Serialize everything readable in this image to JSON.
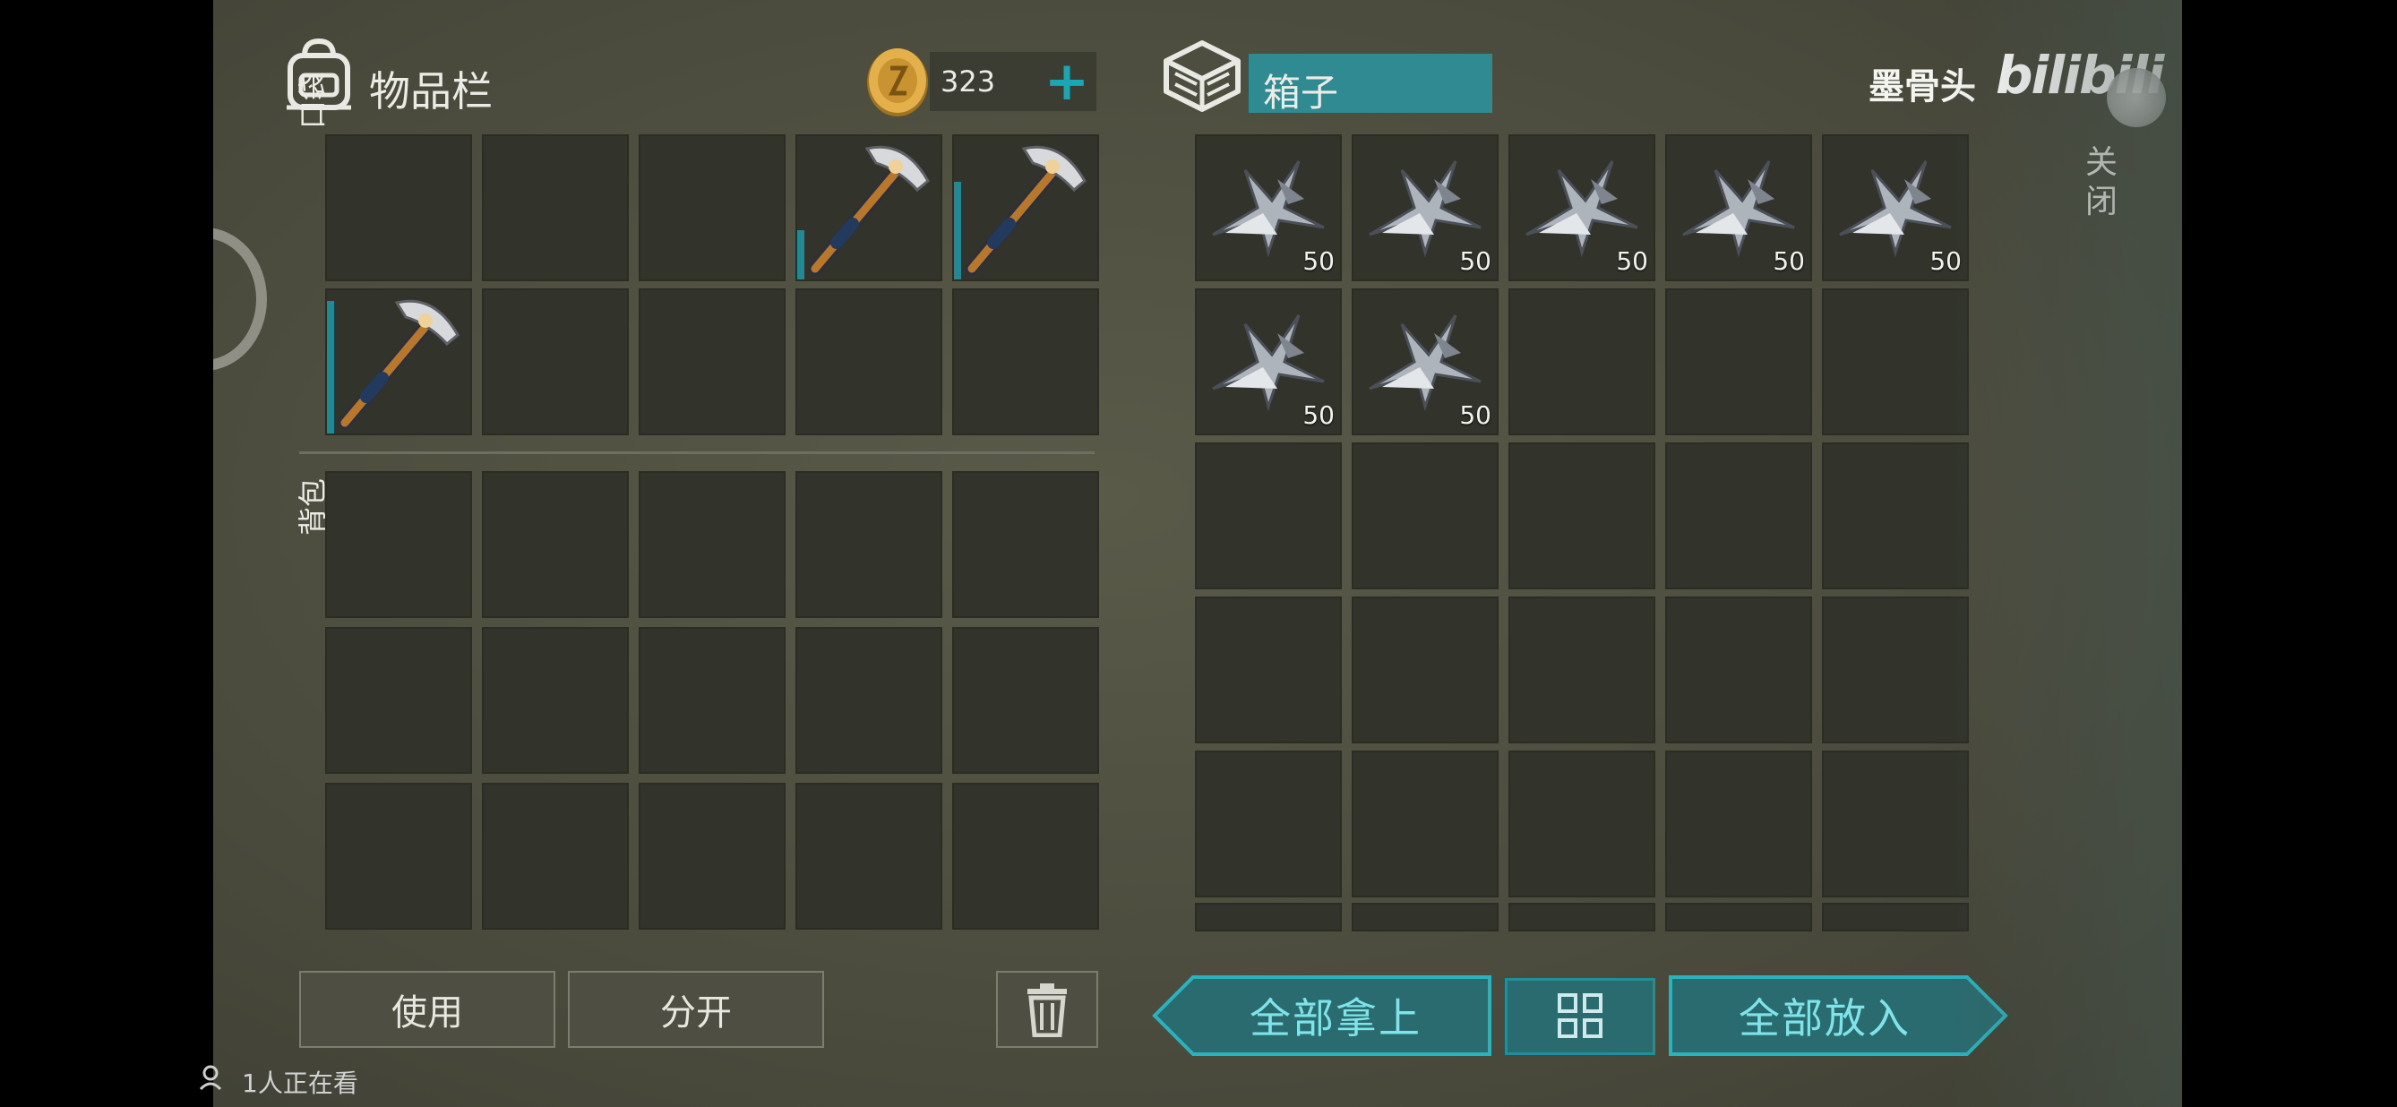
{
  "inventory": {
    "title": "物品栏",
    "coins": "323",
    "add_coins_label": "+",
    "pocket_label": "口袋",
    "backpack_label": "背包",
    "pocket_slots": [
      {
        "item": null
      },
      {
        "item": null
      },
      {
        "item": null
      },
      {
        "item": "pickaxe",
        "durability": 0.35
      },
      {
        "item": "pickaxe",
        "durability": 0.7
      },
      {
        "item": "pickaxe",
        "durability": 0.95
      },
      {
        "item": null
      },
      {
        "item": null
      },
      {
        "item": null
      },
      {
        "item": null
      }
    ],
    "use_button": "使用",
    "split_button": "分开",
    "trash_icon": "trash-icon"
  },
  "container": {
    "title": "箱子",
    "icon": "crate-icon",
    "slots": [
      {
        "item": "metal-scraps",
        "count": "50"
      },
      {
        "item": "metal-scraps",
        "count": "50"
      },
      {
        "item": "metal-scraps",
        "count": "50"
      },
      {
        "item": "metal-scraps",
        "count": "50"
      },
      {
        "item": "metal-scraps",
        "count": "50"
      },
      {
        "item": "metal-scraps",
        "count": "50"
      },
      {
        "item": "metal-scraps",
        "count": "50"
      }
    ],
    "take_all_button": "全部拿上",
    "sort_icon": "grid-icon",
    "put_all_button": "全部放入"
  },
  "close_label": "关闭",
  "watermark": {
    "author": "墨骨头",
    "logo": "bilibili"
  },
  "viewers": "1人正在看",
  "colors": {
    "accent": "#1aa7b4",
    "teal_text": "#7fe3ea",
    "slot_bg": "#32342b"
  }
}
